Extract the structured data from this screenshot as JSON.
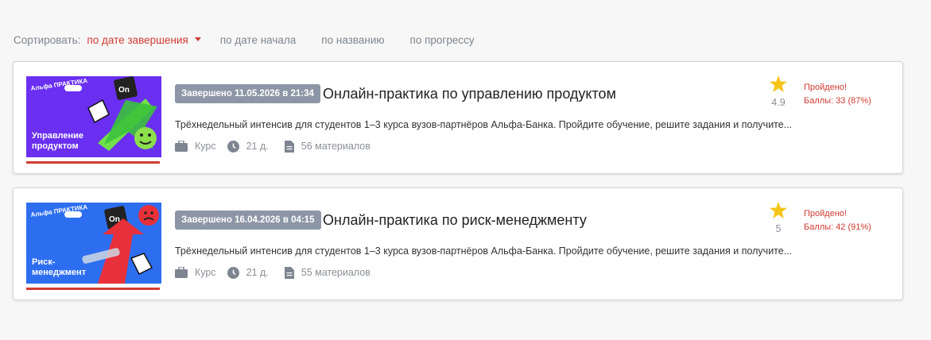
{
  "sort": {
    "label": "Сортировать:",
    "options": [
      "по дате завершения",
      "по дате начала",
      "по названию",
      "по прогрессу"
    ],
    "active": 0
  },
  "courses": [
    {
      "thumb_title_1": "Управление",
      "thumb_title_2": "продуктом",
      "thumb_logo": "Альфа ПРАКТИКА",
      "thumb_key": "On",
      "thumb_color": "#6a2ff0",
      "status": "Завершено 11.05.2026 в 21:34",
      "title": "Онлайн-практика по управлению продуктом",
      "description": "Трёхнедельный интенсив для студентов 1–3 курса вузов-партнёров Альфа-Банка. Пройдите обучение, решите задания и получите...",
      "type": "Курс",
      "duration": "21 д.",
      "materials": "56 материалов",
      "rating": "4.9",
      "result_status": "Пройдено!",
      "result_score": "Баллы: 33 (87%)"
    },
    {
      "thumb_title_1": "Риск-",
      "thumb_title_2": "менеджмент",
      "thumb_logo": "Альфа ПРАКТИКА",
      "thumb_key": "On",
      "thumb_color": "#2d6ef0",
      "status": "Завершено 16.04.2026 в 04:15",
      "title": "Онлайн-практика по риск-менеджменту",
      "description": "Трёхнедельный интенсив для студентов 1–3 курса вузов-партнёров Альфа-Банка. Пройдите обучение, решите задания и получите...",
      "type": "Курс",
      "duration": "21 д.",
      "materials": "55 материалов",
      "rating": "5",
      "result_status": "Пройдено!",
      "result_score": "Баллы: 42 (91%)"
    }
  ],
  "colors": {
    "accent": "#d13b32",
    "badge": "#8c96a6",
    "star": "#f5c518"
  },
  "icons": {
    "type": "briefcase-icon",
    "duration": "clock-icon",
    "materials": "document-icon",
    "rating": "star-icon"
  }
}
